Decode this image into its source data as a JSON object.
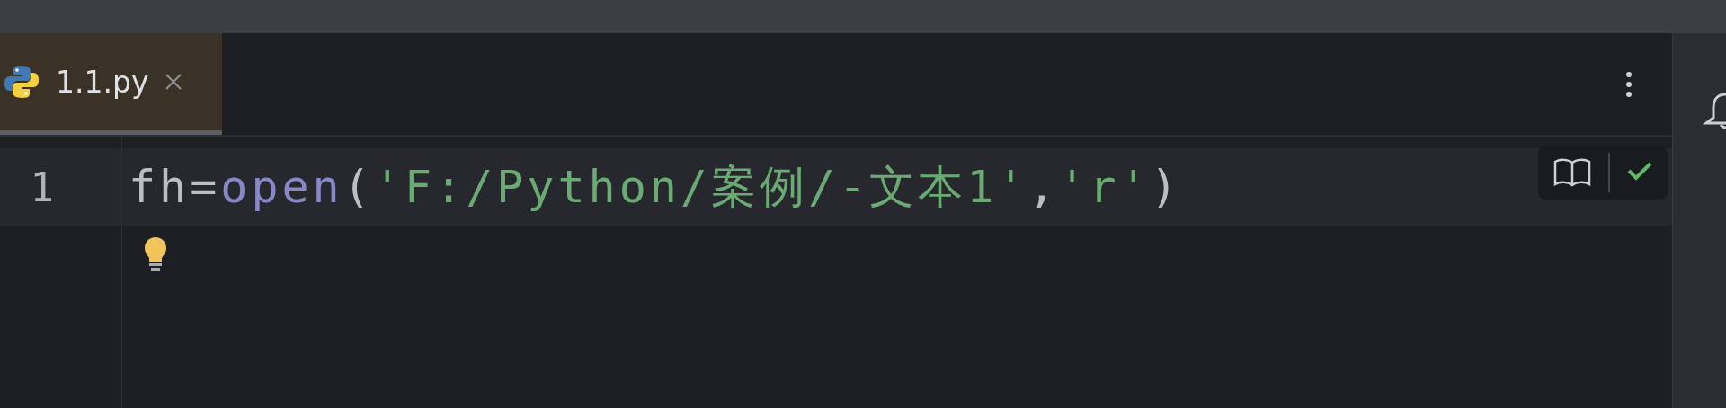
{
  "tabs": [
    {
      "label": "1.1.py",
      "selected": true
    }
  ],
  "editor": {
    "lines": [
      {
        "number": "1",
        "current": true,
        "tokens": [
          {
            "kind": "plain",
            "text": "fh="
          },
          {
            "kind": "builtin",
            "text": "open"
          },
          {
            "kind": "plain",
            "text": "("
          },
          {
            "kind": "string",
            "text": "'F:/Python/案例/-文本1'"
          },
          {
            "kind": "plain",
            "text": ","
          },
          {
            "kind": "string",
            "text": "'r'"
          },
          {
            "kind": "plain",
            "text": ")"
          }
        ]
      }
    ],
    "inspection_ok": true
  }
}
